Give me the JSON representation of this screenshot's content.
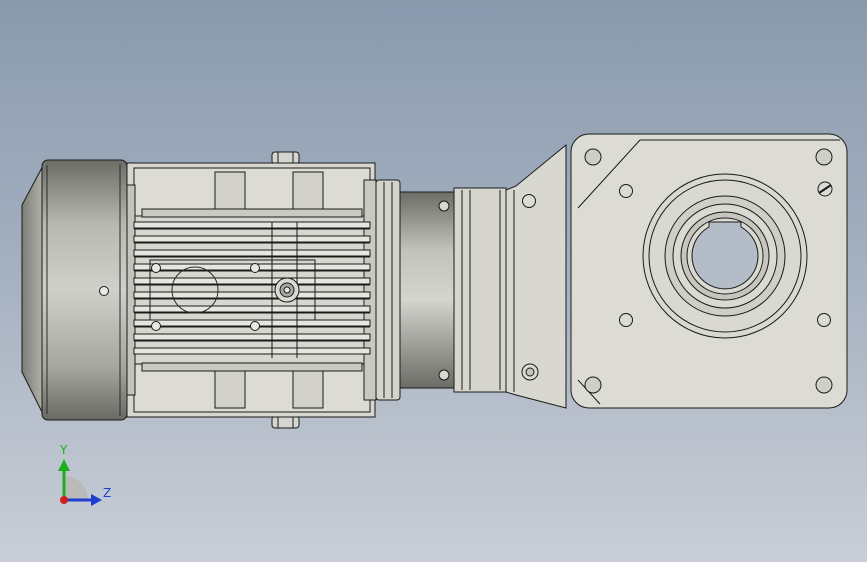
{
  "view": {
    "model": "gear-motor",
    "background_top": "#8a9aae",
    "background_bottom": "#c9ced6",
    "part_color": "#d9d9d2",
    "shadow_color": "#a9a9a1",
    "edge_color": "#1a1a1a"
  },
  "triad": {
    "y_label": "Y",
    "z_label": "Z",
    "y_color": "#1fae1f",
    "z_color": "#1f3fd0",
    "x_color": "#d01f1f"
  }
}
